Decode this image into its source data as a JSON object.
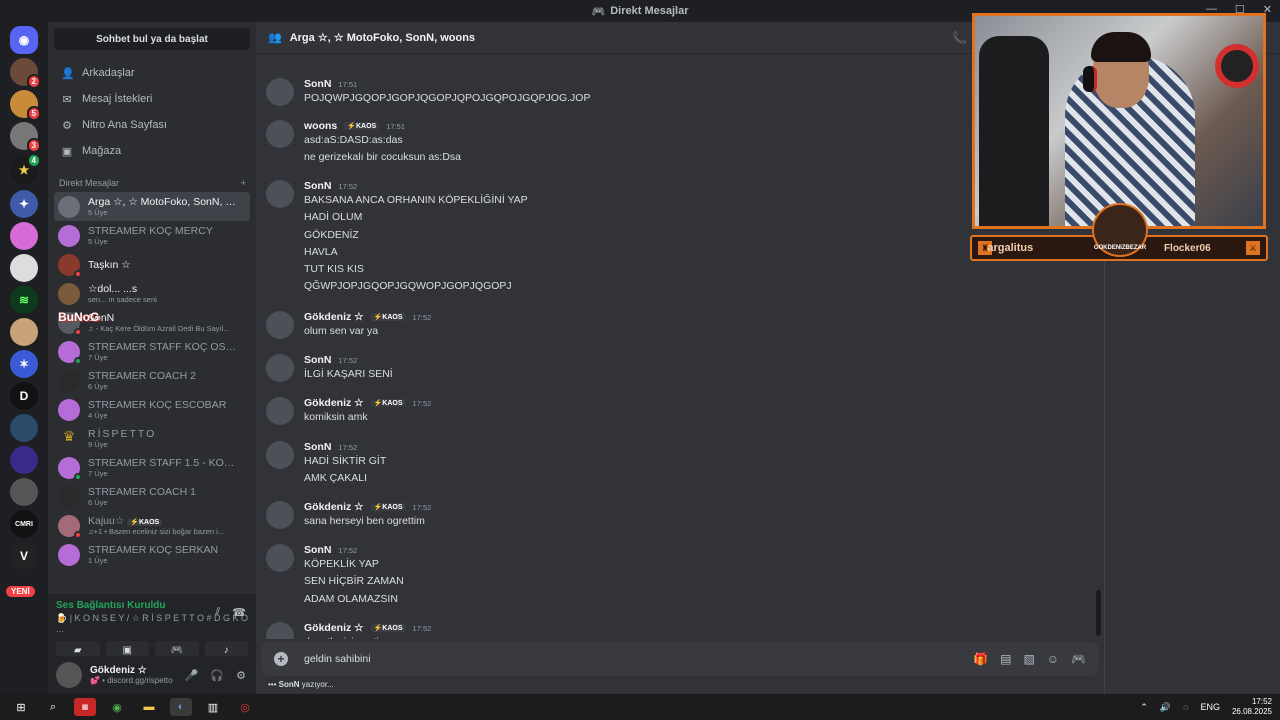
{
  "window": {
    "title": "Direkt Mesajlar"
  },
  "sidebar": {
    "search": "Sohbet bul ya da başlat",
    "nav": [
      {
        "label": "Arkadaşlar",
        "icon": "friends-icon"
      },
      {
        "label": "Mesaj İstekleri",
        "icon": "mail-icon"
      },
      {
        "label": "Nitro Ana Sayfası",
        "icon": "nitro-icon"
      },
      {
        "label": "Mağaza",
        "icon": "shop-icon"
      }
    ],
    "dm_header": "Direkt Mesajlar",
    "dm_add": "+",
    "dms": [
      {
        "name": "Arga ☆, ☆ MotoFoko, SonN, w...",
        "sub": "5 Üye",
        "color": "#6b6f78"
      },
      {
        "name": "STREAMER KOÇ MERCY",
        "sub": "5 Üye",
        "color": "#b66cd6"
      },
      {
        "name": "Taşkın ☆",
        "sub": "",
        "color": "#8a3a2a"
      },
      {
        "name": "☆dol... ...s",
        "sub": "sen... m sadece seni",
        "color": "#7a5a3a"
      },
      {
        "name": "SonN",
        "sub": "♫ - Kaç Kere Öldüm Azrail Dedi Bu Sayıl...",
        "color": "#555a60"
      },
      {
        "name": "STREAMER STAFF KOÇ OSMAN",
        "sub": "7 Üye",
        "color": "#b66cd6"
      },
      {
        "name": "STREAMER COACH 2",
        "sub": "6 Üye",
        "color": "#2a2a2a"
      },
      {
        "name": "STREAMER KOÇ ESCOBAR",
        "sub": "4 Üye",
        "color": "#b66cd6"
      },
      {
        "name": "RİSPETTO",
        "sub": "9 Üye",
        "color": "#c9a227"
      },
      {
        "name": "STREAMER STAFF 1.5 - KOÇ M...",
        "sub": "7 Üye",
        "color": "#b66cd6"
      },
      {
        "name": "STREAMER COACH 1",
        "sub": "6 Üye",
        "color": "#2a2a2a"
      },
      {
        "name": "Kajuu☆",
        "sub": "♫+1 • Bazen eceliniz sizi boğar bazen i...",
        "color": "#a36a7a",
        "tag": "⚡KAOS"
      },
      {
        "name": "STREAMER KOÇ SERKAN",
        "sub": "1 Üye",
        "color": "#b66cd6"
      }
    ],
    "overlay_text": "BuNoG",
    "voice": {
      "status": "Ses Bağlantısı Kuruldu",
      "channel": "🍺 | K O N S E Y / ☆ R İ S P E T T O # D G K O ..."
    },
    "user": {
      "name": "Gökdeniz ☆",
      "status": "💕 • discord.gg/rispetto"
    }
  },
  "servers": {
    "badges": [
      "2",
      "5",
      "3",
      "4"
    ],
    "new_label": "YENİ"
  },
  "chat": {
    "title": "Arga ☆, ☆ MotoFoko, SonN, woons",
    "messages": [
      {
        "author": "SonN",
        "time": "17:51",
        "lines": [
          "POJQWPJGQOPJGOPJQGOPJQPOJGQPOJGQPJOG.JOP"
        ],
        "tag": ""
      },
      {
        "author": "woons",
        "time": "17:51",
        "lines": [
          "asd:aS:DASD:as:das",
          "ne gerizekalı bir cocuksun as:Dsa"
        ],
        "tag": "⚡KAOS"
      },
      {
        "author": "SonN",
        "time": "17:52",
        "lines": [
          "BAKSANA ANCA ORHANIN KÖPEKLİĞİNİ YAP",
          "HADİ OLUM",
          "GÖKDENİZ",
          "HAVLA",
          "TUT KIS KIS",
          "QĞWPJOPJGQOPJGQWOPJGOPJQGOPJ"
        ],
        "tag": ""
      },
      {
        "author": "Gökdeniz ☆",
        "time": "17:52",
        "lines": [
          "olum sen var ya"
        ],
        "tag": "⚡KAOS"
      },
      {
        "author": "SonN",
        "time": "17:52",
        "lines": [
          "İLGİ KAŞARI SENİ"
        ],
        "tag": ""
      },
      {
        "author": "Gökdeniz ☆",
        "time": "17:52",
        "lines": [
          "komiksin amk"
        ],
        "tag": "⚡KAOS"
      },
      {
        "author": "SonN",
        "time": "17:52",
        "lines": [
          "HADİ SİKTİR GİT",
          "AMK ÇAKALI"
        ],
        "tag": ""
      },
      {
        "author": "Gökdeniz ☆",
        "time": "17:52",
        "lines": [
          "sana herseyi ben ogrettim"
        ],
        "tag": "⚡KAOS"
      },
      {
        "author": "SonN",
        "time": "17:52",
        "lines": [
          "KÖPEKLİK YAP",
          "SEN HİÇBİR ZAMAN",
          "ADAM OLAMAZSIN"
        ],
        "tag": ""
      },
      {
        "author": "Gökdeniz ☆",
        "time": "17:52",
        "lines": [
          "denetleyici yaptim"
        ],
        "tag": "⚡KAOS"
      }
    ],
    "composer_value": "geldin sahibini",
    "typing_user": "SonN",
    "typing_text": "yazıyor..."
  },
  "stream_overlay": {
    "left_name": "argalitus",
    "right_name": "Flocker06",
    "logo_text": "GOKDENIZBEZAR"
  },
  "taskbar": {
    "lang": "ENG",
    "time": "17:52",
    "date": "26.08.2025"
  }
}
